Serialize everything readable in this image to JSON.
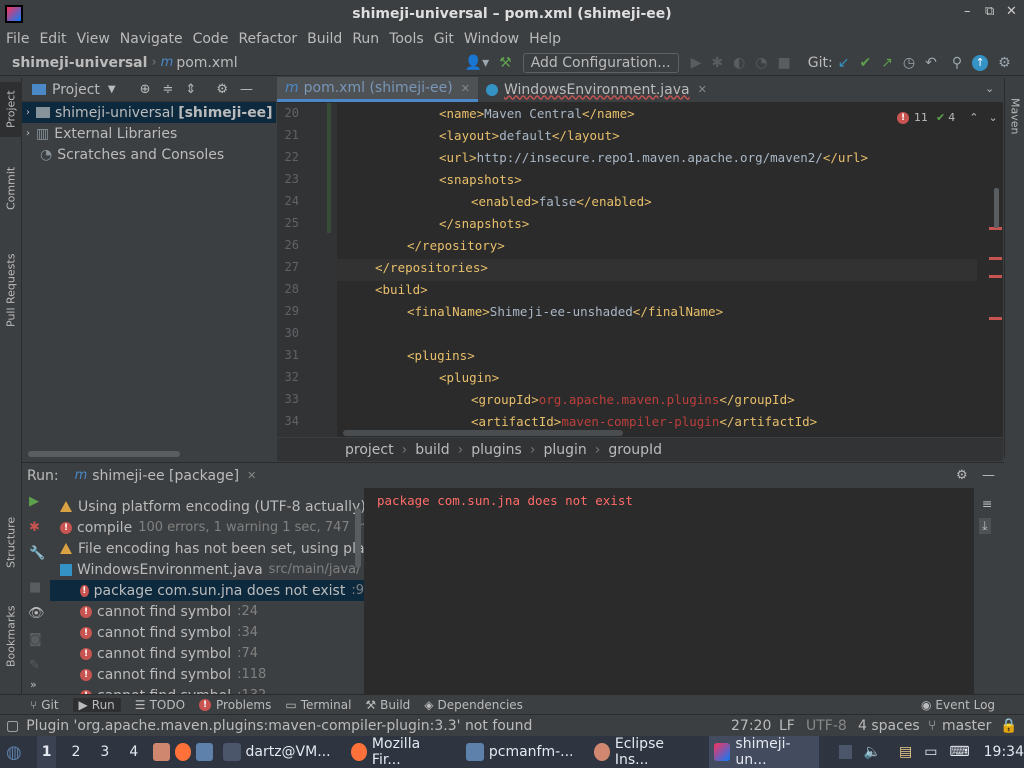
{
  "window": {
    "title": "shimeji-universal – pom.xml (shimeji-ee)"
  },
  "menu": [
    "File",
    "Edit",
    "View",
    "Navigate",
    "Code",
    "Refactor",
    "Build",
    "Run",
    "Tools",
    "Git",
    "Window",
    "Help"
  ],
  "nav": {
    "project": "shimeji-universal",
    "file": "pom.xml"
  },
  "toolbar": {
    "add_configuration": "Add Configuration...",
    "git_label": "Git:"
  },
  "left_tabs": {
    "project": "Project",
    "commit": "Commit",
    "pull_requests": "Pull Requests",
    "structure": "Structure",
    "bookmarks": "Bookmarks"
  },
  "right_tabs": {
    "maven": "Maven"
  },
  "project_panel": {
    "title": "Project",
    "items": [
      {
        "name": "shimeji-universal",
        "module": "[shimeji-ee]"
      },
      {
        "name": "External Libraries"
      },
      {
        "name": "Scratches and Consoles"
      }
    ]
  },
  "editor_tabs": [
    {
      "label": "pom.xml (shimeji-ee)",
      "active": true
    },
    {
      "label": "WindowsEnvironment.java",
      "active": false
    }
  ],
  "inspections": {
    "errors": "11",
    "warnings": "4"
  },
  "code_lines": [
    {
      "n": "20",
      "indent": 3,
      "parts": [
        [
          "tag",
          "<name>"
        ],
        [
          "txt",
          "Maven Central"
        ],
        [
          "tag",
          "</name>"
        ]
      ]
    },
    {
      "n": "21",
      "indent": 3,
      "parts": [
        [
          "tag",
          "<layout>"
        ],
        [
          "txt",
          "default"
        ],
        [
          "tag",
          "</layout>"
        ]
      ]
    },
    {
      "n": "22",
      "indent": 3,
      "parts": [
        [
          "tag",
          "<url>"
        ],
        [
          "txt",
          "http://insecure.repo1.maven.apache.org/maven2/"
        ],
        [
          "tag",
          "</url>"
        ]
      ]
    },
    {
      "n": "23",
      "indent": 3,
      "parts": [
        [
          "tag",
          "<snapshots>"
        ]
      ]
    },
    {
      "n": "24",
      "indent": 4,
      "parts": [
        [
          "tag",
          "<enabled>"
        ],
        [
          "txt",
          "false"
        ],
        [
          "tag",
          "</enabled>"
        ]
      ]
    },
    {
      "n": "25",
      "indent": 3,
      "parts": [
        [
          "tag",
          "</snapshots>"
        ]
      ]
    },
    {
      "n": "26",
      "indent": 2,
      "parts": [
        [
          "tag",
          "</repository>"
        ]
      ]
    },
    {
      "n": "27",
      "indent": 1,
      "parts": [
        [
          "tag",
          "</repositories>"
        ]
      ]
    },
    {
      "n": "28",
      "indent": 1,
      "parts": [
        [
          "tag",
          "<build>"
        ]
      ]
    },
    {
      "n": "29",
      "indent": 2,
      "parts": [
        [
          "tag",
          "<finalName>"
        ],
        [
          "txt",
          "Shimeji-ee-unshaded"
        ],
        [
          "tag",
          "</finalName>"
        ]
      ]
    },
    {
      "n": "30",
      "indent": 0,
      "parts": []
    },
    {
      "n": "31",
      "indent": 2,
      "parts": [
        [
          "tag",
          "<plugins>"
        ]
      ]
    },
    {
      "n": "32",
      "indent": 3,
      "parts": [
        [
          "tag",
          "<plugin>"
        ]
      ]
    },
    {
      "n": "33",
      "indent": 4,
      "parts": [
        [
          "tag",
          "<groupId>"
        ],
        [
          "red",
          "org.apache.maven.plugins"
        ],
        [
          "tag",
          "</groupId>"
        ]
      ]
    },
    {
      "n": "34",
      "indent": 4,
      "parts": [
        [
          "tag",
          "<artifactId>"
        ],
        [
          "red",
          "maven-compiler-plugin"
        ],
        [
          "tag",
          "</artifactId>"
        ]
      ]
    }
  ],
  "breadcrumbs": [
    "project",
    "build",
    "plugins",
    "plugin",
    "groupId"
  ],
  "run": {
    "label": "Run:",
    "tab": "shimeji-ee [package]",
    "tree": [
      {
        "icon": "warn",
        "text": "Using platform encoding (UTF-8 actually)",
        "extra": ""
      },
      {
        "icon": "err",
        "text": "compile",
        "extra": "100 errors, 1 warning 1 sec, 747 ms"
      },
      {
        "icon": "warn",
        "text": "File encoding has not been set, using plat",
        "extra": ""
      },
      {
        "icon": "file",
        "text": "WindowsEnvironment.java",
        "extra": "src/main/java/"
      },
      {
        "icon": "err",
        "text": "package com.sun.jna does not exist",
        "extra": ":9",
        "selected": true
      },
      {
        "icon": "err",
        "text": "cannot find symbol",
        "extra": ":24"
      },
      {
        "icon": "err",
        "text": "cannot find symbol",
        "extra": ":34"
      },
      {
        "icon": "err",
        "text": "cannot find symbol",
        "extra": ":74"
      },
      {
        "icon": "err",
        "text": "cannot find symbol",
        "extra": ":118"
      },
      {
        "icon": "err",
        "text": "cannot find symbol",
        "extra": ":132"
      }
    ],
    "output": "package com.sun.jna does not exist"
  },
  "bottom_tabs": [
    "Git",
    "Run",
    "TODO",
    "Problems",
    "Terminal",
    "Build",
    "Dependencies"
  ],
  "event_log": "Event Log",
  "status": {
    "message": "Plugin 'org.apache.maven.plugins:maven-compiler-plugin:3.3' not found",
    "position": "27:20",
    "line_sep": "LF",
    "encoding": "UTF-8",
    "indent": "4 spaces",
    "branch": "master"
  },
  "taskbar": {
    "workspaces": [
      "1",
      "2",
      "3",
      "4"
    ],
    "apps": [
      "dartz@VM...",
      "Mozilla Fir...",
      "pcmanfm-...",
      "Eclipse Ins...",
      "shimeji-un..."
    ],
    "clock": "19:34"
  }
}
